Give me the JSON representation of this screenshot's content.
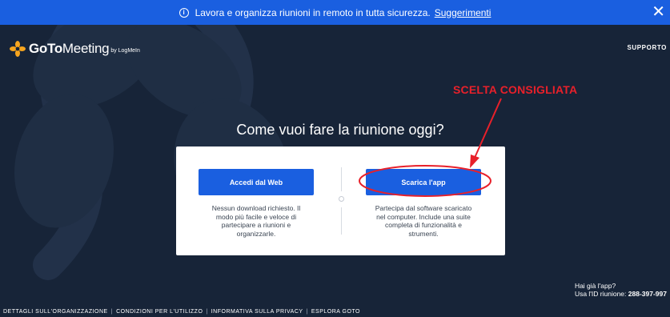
{
  "banner": {
    "message": "Lavora e organizza riunioni in remoto in tutta sicurezza.",
    "link_label": "Suggerimenti",
    "close_symbol": "✕",
    "info_symbol": "i",
    "info_icon": "info-icon",
    "close_icon": "close-icon",
    "color": "#1a5fe0"
  },
  "header": {
    "logo_goto": "GoTo",
    "logo_meeting": "Meeting",
    "logo_by": "by LogMeIn",
    "support_label": "SUPPORTO"
  },
  "annotation": {
    "label": "SCELTA CONSIGLIATA",
    "color": "#e8202a"
  },
  "main": {
    "heading": "Come vuoi fare la riunione oggi?",
    "options": [
      {
        "button_label": "Accedi dal Web",
        "description": "Nessun download richiesto. Il modo più facile e veloce di partecipare a riunioni e organizzarle."
      },
      {
        "button_label": "Scarica l'app",
        "description": "Partecipa dal software scaricato nel computer. Include una suite completa di funzionalità e strumenti."
      }
    ]
  },
  "meeting_info": {
    "question": "Hai già l'app?",
    "prompt": "Usa l'ID riunione:",
    "meeting_id": "288-397-997"
  },
  "footer": {
    "links": [
      "DETTAGLI SULL'ORGANIZZAZIONE",
      "CONDIZIONI PER L'UTILIZZO",
      "INFORMATIVA SULLA PRIVACY",
      "ESPLORA GOTO"
    ],
    "separator": "|"
  },
  "colors": {
    "background": "#172438",
    "accent": "#1a5fe0",
    "card": "#ffffff",
    "annotation": "#e8202a"
  }
}
